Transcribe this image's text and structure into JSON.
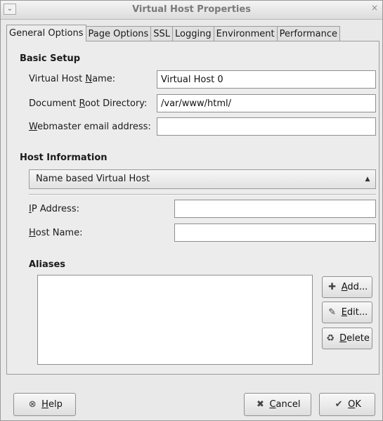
{
  "window": {
    "title": "Virtual Host Properties",
    "menu_glyph": "⌄",
    "close_glyph": "×"
  },
  "tabs": [
    {
      "label": "General Options",
      "active": true
    },
    {
      "label": "Page Options",
      "active": false
    },
    {
      "label": "SSL",
      "active": false
    },
    {
      "label": "Logging",
      "active": false
    },
    {
      "label": "Environment",
      "active": false
    },
    {
      "label": "Performance",
      "active": false
    }
  ],
  "basic_setup": {
    "heading": "Basic Setup",
    "vhost_name_label_pre": "Virtual Host ",
    "vhost_name_label_mnemonic": "N",
    "vhost_name_label_post": "ame:",
    "vhost_name_value": "Virtual Host 0",
    "docroot_label_pre": "Document ",
    "docroot_label_mnemonic": "R",
    "docroot_label_post": "oot Directory:",
    "docroot_value": "/var/www/html/",
    "webmaster_label_mnemonic": "W",
    "webmaster_label_post": "ebmaster email address:",
    "webmaster_value": ""
  },
  "host_info": {
    "heading": "Host Information",
    "type_selected": "Name based Virtual Host",
    "ip_label_mnemonic": "I",
    "ip_label_post": "P Address:",
    "ip_value": "",
    "hostname_label_mnemonic": "H",
    "hostname_label_post": "ost Name:",
    "hostname_value": ""
  },
  "aliases": {
    "heading": "Aliases",
    "add_mnemonic": "A",
    "add_post": "dd...",
    "edit_mnemonic": "E",
    "edit_post": "dit...",
    "delete_mnemonic": "D",
    "delete_post": "elete"
  },
  "footer": {
    "help_mnemonic": "H",
    "help_post": "elp",
    "cancel_mnemonic": "C",
    "cancel_post": "ancel",
    "ok_mnemonic": "O",
    "ok_post": "K"
  },
  "icons": {
    "add": "add-icon",
    "edit": "wrench-icon",
    "delete": "trash-icon",
    "help": "help-icon",
    "cancel": "cancel-icon",
    "ok": "check-icon"
  }
}
